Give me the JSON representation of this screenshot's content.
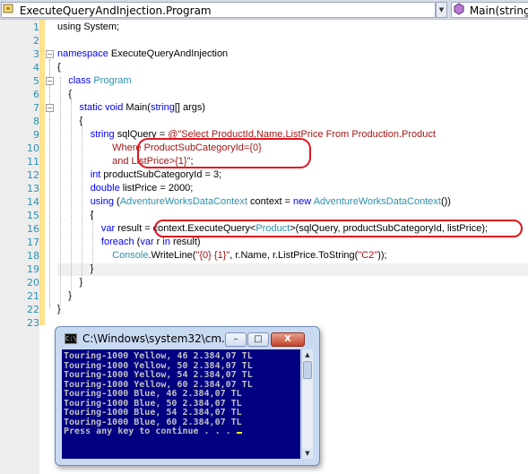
{
  "navbar": {
    "type_combo": "ExecuteQueryAndInjection.Program",
    "member_combo": "Main(string[] args)"
  },
  "editor": {
    "lines": [
      {
        "n": "1",
        "t": [
          [
            "",
            "using System;"
          ]
        ]
      },
      {
        "n": "2",
        "t": []
      },
      {
        "n": "3",
        "t": [
          [
            "kw",
            "namespace"
          ],
          [
            "",
            " ExecuteQueryAndInjection"
          ]
        ]
      },
      {
        "n": "4",
        "t": [
          [
            "",
            "{"
          ]
        ]
      },
      {
        "n": "5",
        "t": [
          [
            "",
            "    "
          ],
          [
            "kw",
            "class"
          ],
          [
            "",
            " "
          ],
          [
            "ty",
            "Program"
          ]
        ]
      },
      {
        "n": "6",
        "t": [
          [
            "",
            "    {"
          ]
        ]
      },
      {
        "n": "7",
        "t": [
          [
            "",
            "        "
          ],
          [
            "kw",
            "static void"
          ],
          [
            "",
            " Main("
          ],
          [
            "kw",
            "string"
          ],
          [
            "",
            "[] args)"
          ]
        ]
      },
      {
        "n": "8",
        "t": [
          [
            "",
            "        {"
          ]
        ]
      },
      {
        "n": "9",
        "t": [
          [
            "",
            "            "
          ],
          [
            "kw",
            "string"
          ],
          [
            "",
            " sqlQuery = "
          ],
          [
            "st",
            "@\"Select ProductId,Name,ListPrice From Production.Product"
          ]
        ]
      },
      {
        "n": "10",
        "t": [
          [
            "st",
            "                    Where ProductSubCategoryId={0}"
          ]
        ]
      },
      {
        "n": "11",
        "t": [
          [
            "st",
            "                    and ListPrice>{1}\""
          ],
          [
            "",
            ";"
          ]
        ]
      },
      {
        "n": "12",
        "t": [
          [
            "",
            "            "
          ],
          [
            "kw",
            "int"
          ],
          [
            "",
            " productSubCategoryId = 3;"
          ]
        ]
      },
      {
        "n": "13",
        "t": [
          [
            "",
            "            "
          ],
          [
            "kw",
            "double"
          ],
          [
            "",
            " listPrice = 2000;"
          ]
        ]
      },
      {
        "n": "14",
        "t": [
          [
            "",
            "            "
          ],
          [
            "kw",
            "using"
          ],
          [
            "",
            " ("
          ],
          [
            "ty",
            "AdventureWorksDataContext"
          ],
          [
            "",
            " context = "
          ],
          [
            "kw",
            "new"
          ],
          [
            "",
            " "
          ],
          [
            "ty",
            "AdventureWorksDataContext"
          ],
          [
            "",
            "())"
          ]
        ]
      },
      {
        "n": "15",
        "t": [
          [
            "",
            "            {"
          ]
        ]
      },
      {
        "n": "16",
        "t": [
          [
            "",
            "                "
          ],
          [
            "kw",
            "var"
          ],
          [
            "",
            " result = context.ExecuteQuery<"
          ],
          [
            "ty",
            "Product"
          ],
          [
            "",
            ">(sqlQuery, productSubCategoryId, listPrice);"
          ]
        ]
      },
      {
        "n": "17",
        "t": [
          [
            "",
            "                "
          ],
          [
            "kw",
            "foreach"
          ],
          [
            "",
            " ("
          ],
          [
            "kw",
            "var"
          ],
          [
            "",
            " r "
          ],
          [
            "kw",
            "in"
          ],
          [
            "",
            " result)"
          ]
        ]
      },
      {
        "n": "18",
        "t": [
          [
            "",
            "                    "
          ],
          [
            "ty",
            "Console"
          ],
          [
            "",
            ".WriteLine("
          ],
          [
            "st",
            "\"{0} {1}\""
          ],
          [
            "",
            ", r.Name, r.ListPrice.ToString("
          ],
          [
            "st",
            "\"C2\""
          ],
          [
            "",
            "));"
          ]
        ]
      },
      {
        "n": "19",
        "t": [
          [
            "",
            "            }"
          ]
        ]
      },
      {
        "n": "20",
        "t": [
          [
            "",
            "        }"
          ]
        ]
      },
      {
        "n": "21",
        "t": [
          [
            "",
            "    }"
          ]
        ]
      },
      {
        "n": "22",
        "t": [
          [
            "",
            "}"
          ]
        ]
      },
      {
        "n": "23",
        "t": []
      }
    ]
  },
  "console": {
    "title": "C:\\Windows\\system32\\cm...",
    "minimize": "–",
    "maximize": "□",
    "close": "X",
    "lines": [
      "Touring-1000 Yellow, 46 2.384,07 TL",
      "Touring-1000 Yellow, 50 2.384,07 TL",
      "Touring-1000 Yellow, 54 2.384,07 TL",
      "Touring-1000 Yellow, 60 2.384,07 TL",
      "Touring-1000 Blue, 46 2.384,07 TL",
      "Touring-1000 Blue, 50 2.384,07 TL",
      "Touring-1000 Blue, 54 2.384,07 TL",
      "Touring-1000 Blue, 60 2.384,07 TL",
      "Press any key to continue . . . "
    ]
  },
  "colors": {
    "keyword": "#0000ff",
    "type": "#2b91af",
    "string": "#a31515",
    "annotation": "#e0141e",
    "console_bg": "#000080"
  }
}
